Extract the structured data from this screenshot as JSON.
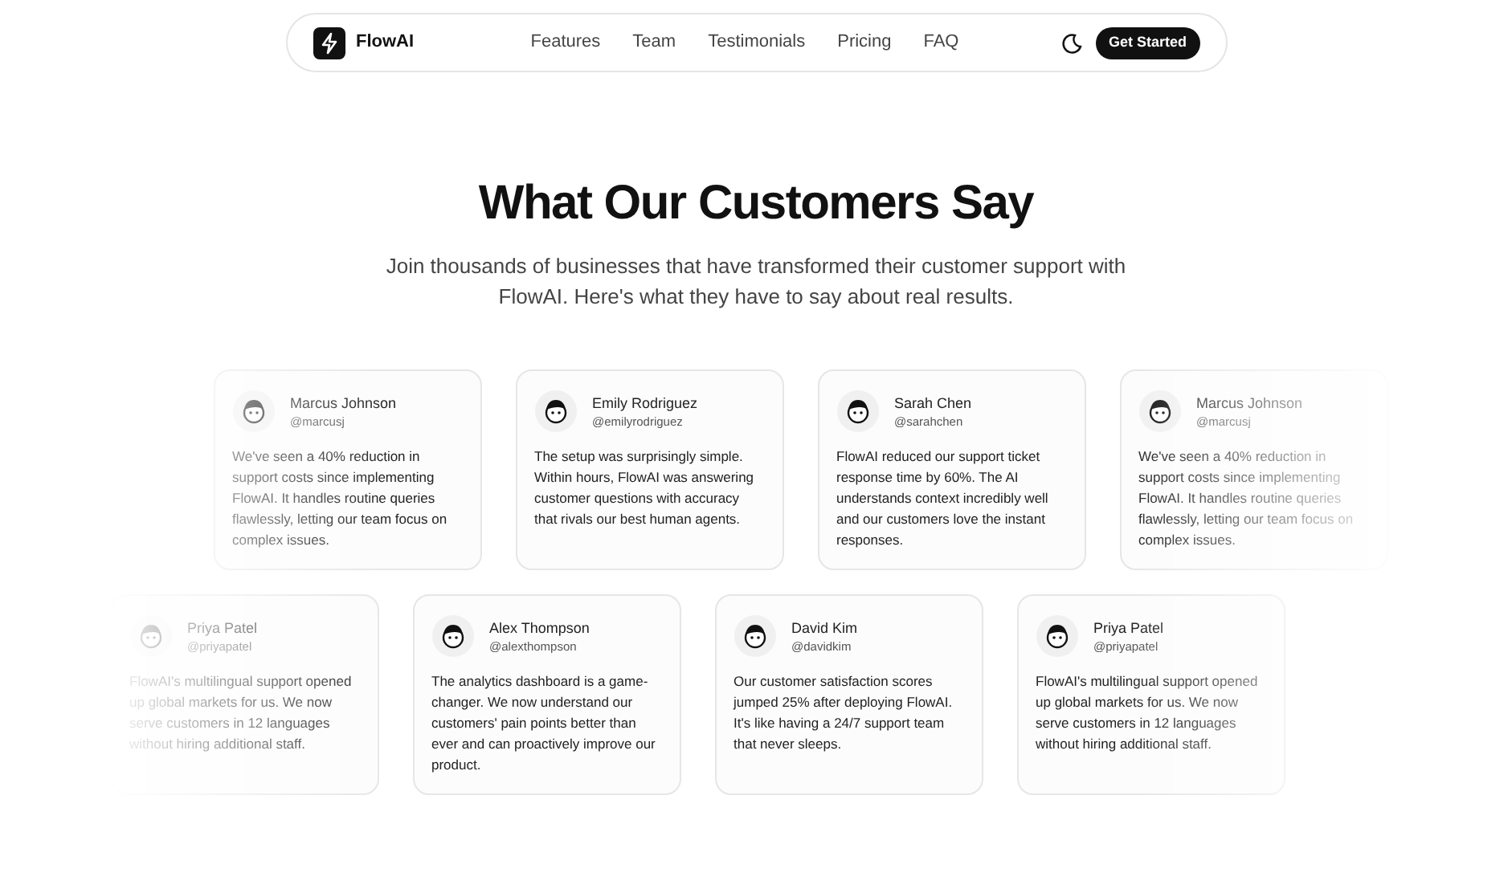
{
  "nav": {
    "brand": "FlowAI",
    "links": [
      "Features",
      "Team",
      "Testimonials",
      "Pricing",
      "FAQ"
    ],
    "cta": "Get Started"
  },
  "hero": {
    "title": "What Our Customers Say",
    "subtitle": "Join thousands of businesses that have transformed their customer support with FlowAI. Here's what they have to say about real results."
  },
  "rows": [
    {
      "cards": [
        {
          "name": "Marcus Johnson",
          "handle": "@marcusj",
          "quote": "We've seen a 40% reduction in support costs since implementing FlowAI. It handles routine queries flawlessly, letting our team focus on complex issues."
        },
        {
          "name": "Emily Rodriguez",
          "handle": "@emilyrodriguez",
          "quote": "The setup was surprisingly simple. Within hours, FlowAI was answering customer questions with accuracy that rivals our best human agents."
        },
        {
          "name": "Sarah Chen",
          "handle": "@sarahchen",
          "quote": "FlowAI reduced our support ticket response time by 60%. The AI understands context incredibly well and our customers love the instant responses."
        },
        {
          "name": "Marcus Johnson",
          "handle": "@marcusj",
          "quote": "We've seen a 40% reduction in support costs since implementing FlowAI. It handles routine queries flawlessly, letting our team focus on complex issues."
        }
      ]
    },
    {
      "cards": [
        {
          "name": "Priya Patel",
          "handle": "@priyapatel",
          "quote": "FlowAI's multilingual support opened up global markets for us. We now serve customers in 12 languages without hiring additional staff."
        },
        {
          "name": "Alex Thompson",
          "handle": "@alexthompson",
          "quote": "The analytics dashboard is a game-changer. We now understand our customers' pain points better than ever and can proactively improve our product."
        },
        {
          "name": "David Kim",
          "handle": "@davidkim",
          "quote": "Our customer satisfaction scores jumped 25% after deploying FlowAI. It's like having a 24/7 support team that never sleeps."
        },
        {
          "name": "Priya Patel",
          "handle": "@priyapatel",
          "quote": "FlowAI's multilingual support opened up global markets for us. We now serve customers in 12 languages without hiring additional staff."
        }
      ]
    }
  ]
}
